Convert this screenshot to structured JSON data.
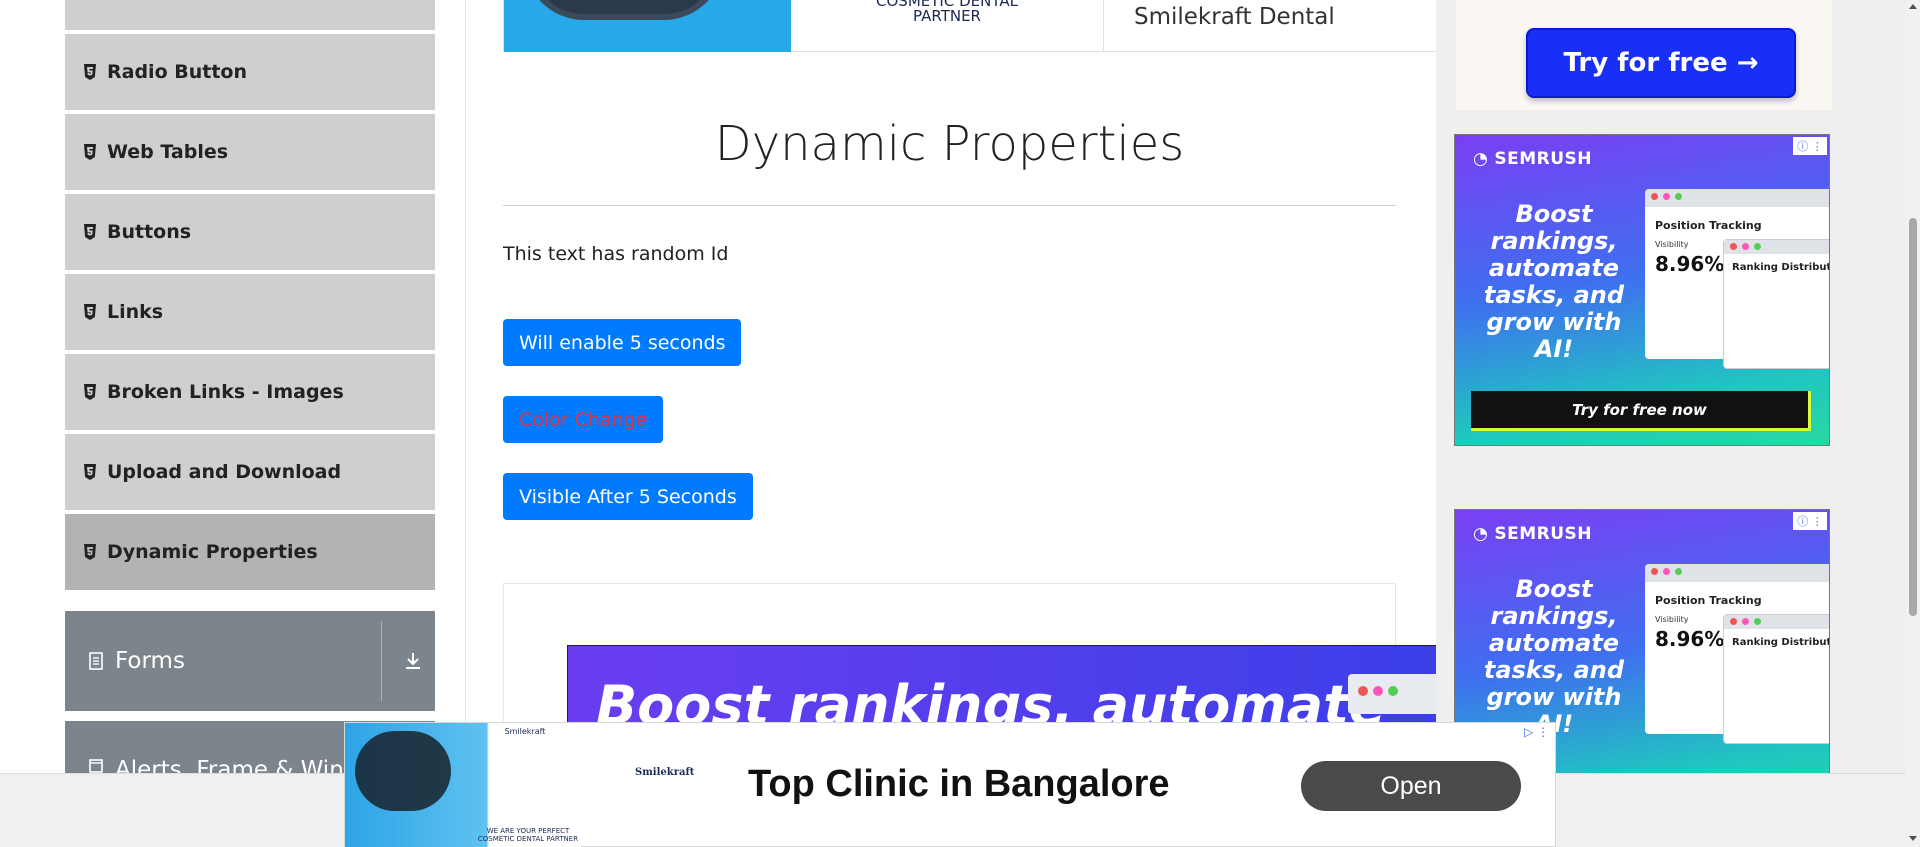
{
  "sidebar": {
    "items": [
      {
        "label": "Radio Button"
      },
      {
        "label": "Web Tables"
      },
      {
        "label": "Buttons"
      },
      {
        "label": "Links"
      },
      {
        "label": "Broken Links - Images"
      },
      {
        "label": "Upload and Download"
      },
      {
        "label": "Dynamic Properties",
        "active": true
      }
    ],
    "groups": [
      {
        "label": "Forms"
      },
      {
        "label": "Alerts, Frame & Windows"
      }
    ]
  },
  "top_banner": {
    "line1": "COSMETIC DENTAL",
    "line2": "PARTNER",
    "brand": "Smilekraft Dental"
  },
  "main": {
    "title": "Dynamic Properties",
    "random_text": "This text has random Id",
    "buttons": {
      "enable_after": "Will enable 5 seconds",
      "color_change": "Color Change",
      "visible_after": "Visible After 5 Seconds"
    }
  },
  "ad_big": {
    "text": "Boost rankings, automate"
  },
  "right_ads": {
    "try_free": "Try for free →",
    "semrush": {
      "logo": "SEMRUSH",
      "headline": "Boost rankings, automate tasks, and grow with AI!",
      "card_title": "Position Tracking",
      "visibility_label": "Visibility",
      "visibility_value": "8.96%",
      "card2_title": "Ranking Distribution",
      "cta": "Try for free now"
    }
  },
  "bottom_ad": {
    "headline": "Top Clinic in Bangalore",
    "open": "Open",
    "logo": "Smilekraft",
    "small_logo": "Smilekraft",
    "tagline": "WE ARE YOUR PERFECT COSMETIC DENTAL PARTNER"
  },
  "colors": {
    "primary_button": "#007bff",
    "color_change_text": "#dc3545",
    "sidebar_item": "#cfcfcf",
    "sidebar_active": "#b3b3b3",
    "group_header": "#7d858c"
  }
}
